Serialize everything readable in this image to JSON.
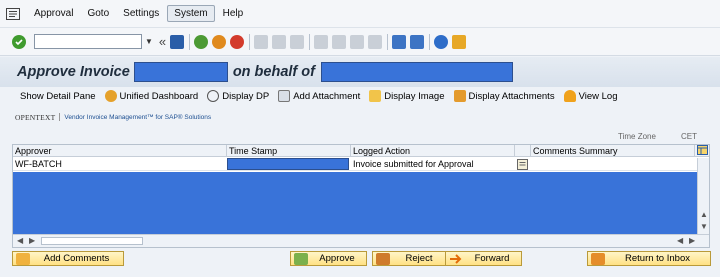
{
  "menubar": {
    "items": [
      "Approval",
      "Goto",
      "Settings",
      "System",
      "Help"
    ],
    "underline": [
      "A",
      "G",
      "S",
      "y",
      "H"
    ]
  },
  "stdbar": {
    "command_value": ""
  },
  "title": {
    "part1": "Approve Invoice",
    "part2": "on behalf of"
  },
  "appbar": {
    "items": [
      {
        "label": "Show Detail Pane",
        "icon": "none"
      },
      {
        "label": "Unified Dashboard",
        "icon": "dashboard-icon"
      },
      {
        "label": "Display DP",
        "icon": "glasses-icon"
      },
      {
        "label": "Add Attachment",
        "icon": "attachment-icon"
      },
      {
        "label": "Display Image",
        "icon": "image-icon"
      },
      {
        "label": "Display Attachments",
        "icon": "attachments-icon"
      },
      {
        "label": "View Log",
        "icon": "log-icon"
      }
    ]
  },
  "brand": {
    "opentext": "OPENTEXT",
    "vim": "Vendor Invoice Management™ for SAP® Solutions"
  },
  "partial_header": {
    "col_a": "Time Zone",
    "col_b": "CET"
  },
  "table": {
    "columns": [
      "Approver",
      "Time Stamp",
      "Logged Action",
      "",
      "Comments Summary"
    ],
    "rows": [
      {
        "approver": "WF-BATCH",
        "time_stamp": "",
        "logged_action": "Invoice submitted for Approval",
        "comments": ""
      }
    ]
  },
  "bottom_buttons": {
    "add_comments": "Add Comments",
    "approve": "Approve",
    "reject": "Reject",
    "forward": "Forward",
    "return_to_inbox": "Return to Inbox"
  },
  "colors": {
    "redaction": "#3973d9",
    "button_bg": "#ffe184",
    "header_bg": "#eef2f7"
  }
}
